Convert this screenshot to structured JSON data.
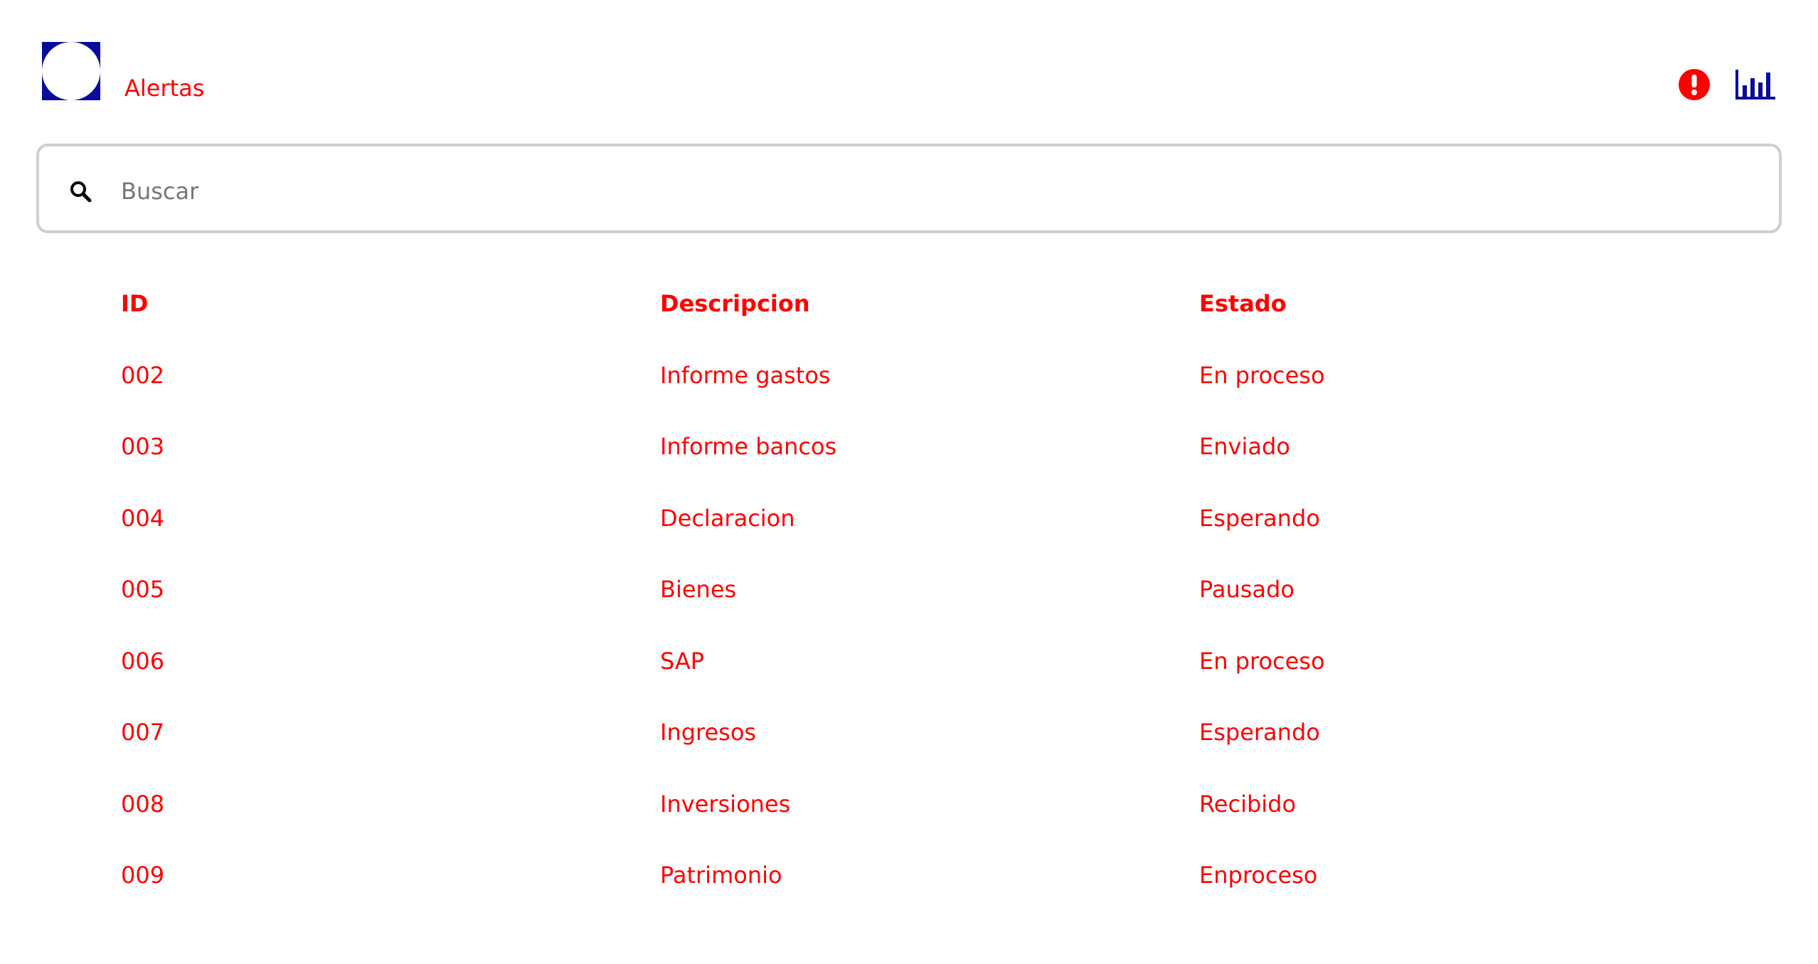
{
  "header": {
    "title": "Alertas",
    "logo_icon": "logo-icon",
    "alert_icon": "alert-icon",
    "chart_icon": "bar-chart-icon"
  },
  "search": {
    "placeholder": "Buscar",
    "value": ""
  },
  "table": {
    "columns": [
      "ID",
      "Descripcion",
      "Estado"
    ],
    "rows": [
      {
        "id": "002",
        "desc": "Informe gastos",
        "state": "En proceso"
      },
      {
        "id": "003",
        "desc": "Informe bancos",
        "state": "Enviado"
      },
      {
        "id": "004",
        "desc": "Declaracion",
        "state": "Esperando"
      },
      {
        "id": "005",
        "desc": "Bienes",
        "state": "Pausado"
      },
      {
        "id": "006",
        "desc": "SAP",
        "state": "En proceso"
      },
      {
        "id": "007",
        "desc": "Ingresos",
        "state": "Esperando"
      },
      {
        "id": "008",
        "desc": "Inversiones",
        "state": "Recibido"
      },
      {
        "id": "009",
        "desc": "Patrimonio",
        "state": "Enproceso"
      }
    ]
  },
  "colors": {
    "accent_red": "#ff0000",
    "brand_blue": "#0a0a9c",
    "border_gray": "#cfcfcf"
  }
}
